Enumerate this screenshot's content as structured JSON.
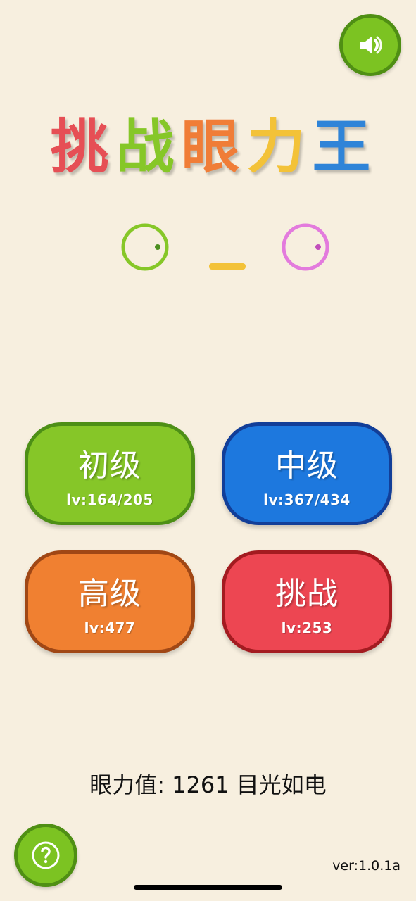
{
  "title": {
    "chars": [
      "挑",
      "战",
      "眼",
      "力",
      "王"
    ],
    "colors": [
      "#e64f55",
      "#86c728",
      "#f07d37",
      "#f3c238",
      "#2f84d8"
    ]
  },
  "eyes_colors": {
    "left": "#86c728",
    "mouth": "#f3c238",
    "right": "#e37bdd"
  },
  "buttons": {
    "primary": {
      "label": "初级",
      "level": "lv:164/205",
      "color": "#86c628"
    },
    "middle": {
      "label": "中级",
      "level": "lv:367/434",
      "color": "#1d78de"
    },
    "advanced": {
      "label": "高级",
      "level": "lv:477",
      "color": "#f08031"
    },
    "challenge": {
      "label": "挑战",
      "level": "lv:253",
      "color": "#ed4652"
    }
  },
  "score_text": "眼力值: 1261 目光如电",
  "version_text": "ver:1.0.1a",
  "icons": {
    "sound": "speaker-icon",
    "help": "question-icon"
  }
}
